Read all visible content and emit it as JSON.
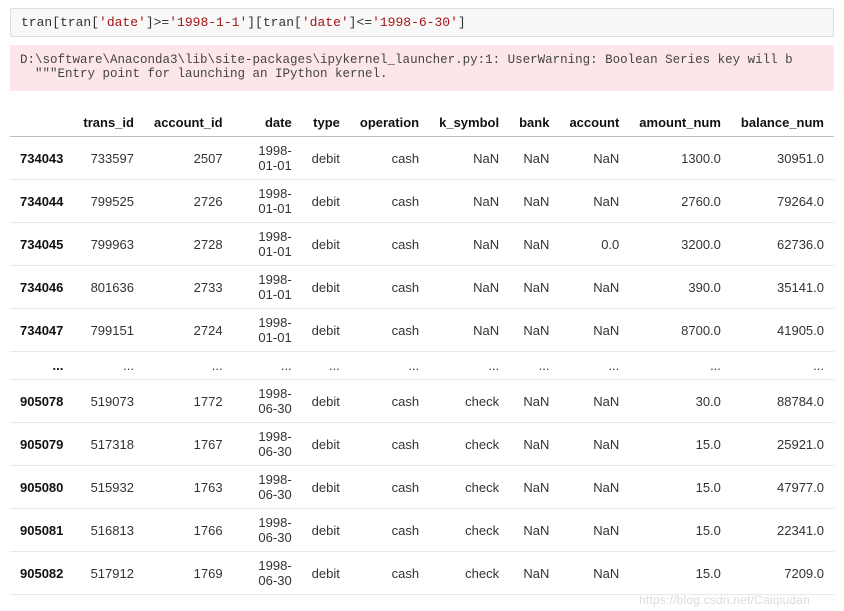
{
  "code": {
    "prefix": "tran[tran[",
    "k1": "'date'",
    "op1": "]>=",
    "v1": "'1998-1-1'",
    "mid": "][tran[",
    "k2": "'date'",
    "op2": "]<=",
    "v2": "'1998-6-30'",
    "suffix": "]"
  },
  "warning": {
    "line1": "D:\\software\\Anaconda3\\lib\\site-packages\\ipykernel_launcher.py:1: UserWarning: Boolean Series key will b",
    "line2": "  \"\"\"Entry point for launching an IPython kernel."
  },
  "df": {
    "columns": [
      "trans_id",
      "account_id",
      "date",
      "type",
      "operation",
      "k_symbol",
      "bank",
      "account",
      "amount_num",
      "balance_num"
    ],
    "rows": [
      {
        "idx": "734043",
        "trans_id": "733597",
        "account_id": "2507",
        "date": "1998-01-01",
        "type": "debit",
        "operation": "cash",
        "k_symbol": "NaN",
        "bank": "NaN",
        "account": "NaN",
        "amount_num": "1300.0",
        "balance_num": "30951.0"
      },
      {
        "idx": "734044",
        "trans_id": "799525",
        "account_id": "2726",
        "date": "1998-01-01",
        "type": "debit",
        "operation": "cash",
        "k_symbol": "NaN",
        "bank": "NaN",
        "account": "NaN",
        "amount_num": "2760.0",
        "balance_num": "79264.0"
      },
      {
        "idx": "734045",
        "trans_id": "799963",
        "account_id": "2728",
        "date": "1998-01-01",
        "type": "debit",
        "operation": "cash",
        "k_symbol": "NaN",
        "bank": "NaN",
        "account": "0.0",
        "amount_num": "3200.0",
        "balance_num": "62736.0"
      },
      {
        "idx": "734046",
        "trans_id": "801636",
        "account_id": "2733",
        "date": "1998-01-01",
        "type": "debit",
        "operation": "cash",
        "k_symbol": "NaN",
        "bank": "NaN",
        "account": "NaN",
        "amount_num": "390.0",
        "balance_num": "35141.0"
      },
      {
        "idx": "734047",
        "trans_id": "799151",
        "account_id": "2724",
        "date": "1998-01-01",
        "type": "debit",
        "operation": "cash",
        "k_symbol": "NaN",
        "bank": "NaN",
        "account": "NaN",
        "amount_num": "8700.0",
        "balance_num": "41905.0"
      },
      {
        "idx": "...",
        "trans_id": "...",
        "account_id": "...",
        "date": "...",
        "type": "...",
        "operation": "...",
        "k_symbol": "...",
        "bank": "...",
        "account": "...",
        "amount_num": "...",
        "balance_num": "..."
      },
      {
        "idx": "905078",
        "trans_id": "519073",
        "account_id": "1772",
        "date": "1998-06-30",
        "type": "debit",
        "operation": "cash",
        "k_symbol": "check",
        "bank": "NaN",
        "account": "NaN",
        "amount_num": "30.0",
        "balance_num": "88784.0"
      },
      {
        "idx": "905079",
        "trans_id": "517318",
        "account_id": "1767",
        "date": "1998-06-30",
        "type": "debit",
        "operation": "cash",
        "k_symbol": "check",
        "bank": "NaN",
        "account": "NaN",
        "amount_num": "15.0",
        "balance_num": "25921.0"
      },
      {
        "idx": "905080",
        "trans_id": "515932",
        "account_id": "1763",
        "date": "1998-06-30",
        "type": "debit",
        "operation": "cash",
        "k_symbol": "check",
        "bank": "NaN",
        "account": "NaN",
        "amount_num": "15.0",
        "balance_num": "47977.0"
      },
      {
        "idx": "905081",
        "trans_id": "516813",
        "account_id": "1766",
        "date": "1998-06-30",
        "type": "debit",
        "operation": "cash",
        "k_symbol": "check",
        "bank": "NaN",
        "account": "NaN",
        "amount_num": "15.0",
        "balance_num": "22341.0"
      },
      {
        "idx": "905082",
        "trans_id": "517912",
        "account_id": "1769",
        "date": "1998-06-30",
        "type": "debit",
        "operation": "cash",
        "k_symbol": "check",
        "bank": "NaN",
        "account": "NaN",
        "amount_num": "15.0",
        "balance_num": "7209.0"
      }
    ]
  },
  "watermark": "https://blog.csdn.net/Caiqiudan"
}
